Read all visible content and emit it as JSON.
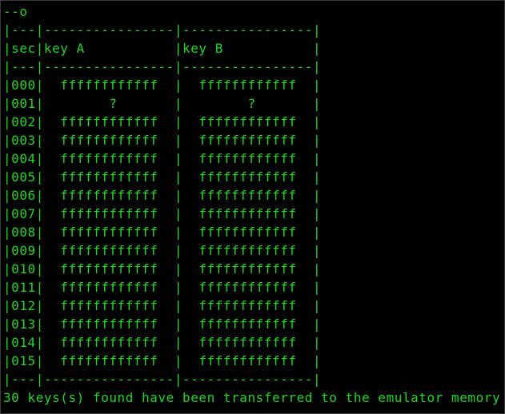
{
  "terminal": {
    "header_line": "--o",
    "table": {
      "top_border": "|---|----------------|----------------|",
      "header_row": "|sec|key A           |key B           |",
      "header_sep": "|---|----------------|----------------|",
      "rows": [
        "|000|  ffffffffffff  |  ffffffffffff  |",
        "|001|        ?       |        ?       |",
        "|002|  ffffffffffff  |  ffffffffffff  |",
        "|003|  ffffffffffff  |  ffffffffffff  |",
        "|004|  ffffffffffff  |  ffffffffffff  |",
        "|005|  ffffffffffff  |  ffffffffffff  |",
        "|006|  ffffffffffff  |  ffffffffffff  |",
        "|007|  ffffffffffff  |  ffffffffffff  |",
        "|008|  ffffffffffff  |  ffffffffffff  |",
        "|009|  ffffffffffff  |  ffffffffffff  |",
        "|010|  ffffffffffff  |  ffffffffffff  |",
        "|011|  ffffffffffff  |  ffffffffffff  |",
        "|012|  ffffffffffff  |  ffffffffffff  |",
        "|013|  ffffffffffff  |  ffffffffffff  |",
        "|014|  ffffffffffff  |  ffffffffffff  |",
        "|015|  ffffffffffff  |  ffffffffffff  |"
      ],
      "bottom_border": "|---|----------------|----------------|"
    },
    "status_message": "30 keys(s) found have been transferred to the emulator memory",
    "colors": {
      "background": "#000000",
      "text": "#1ed81e"
    }
  }
}
